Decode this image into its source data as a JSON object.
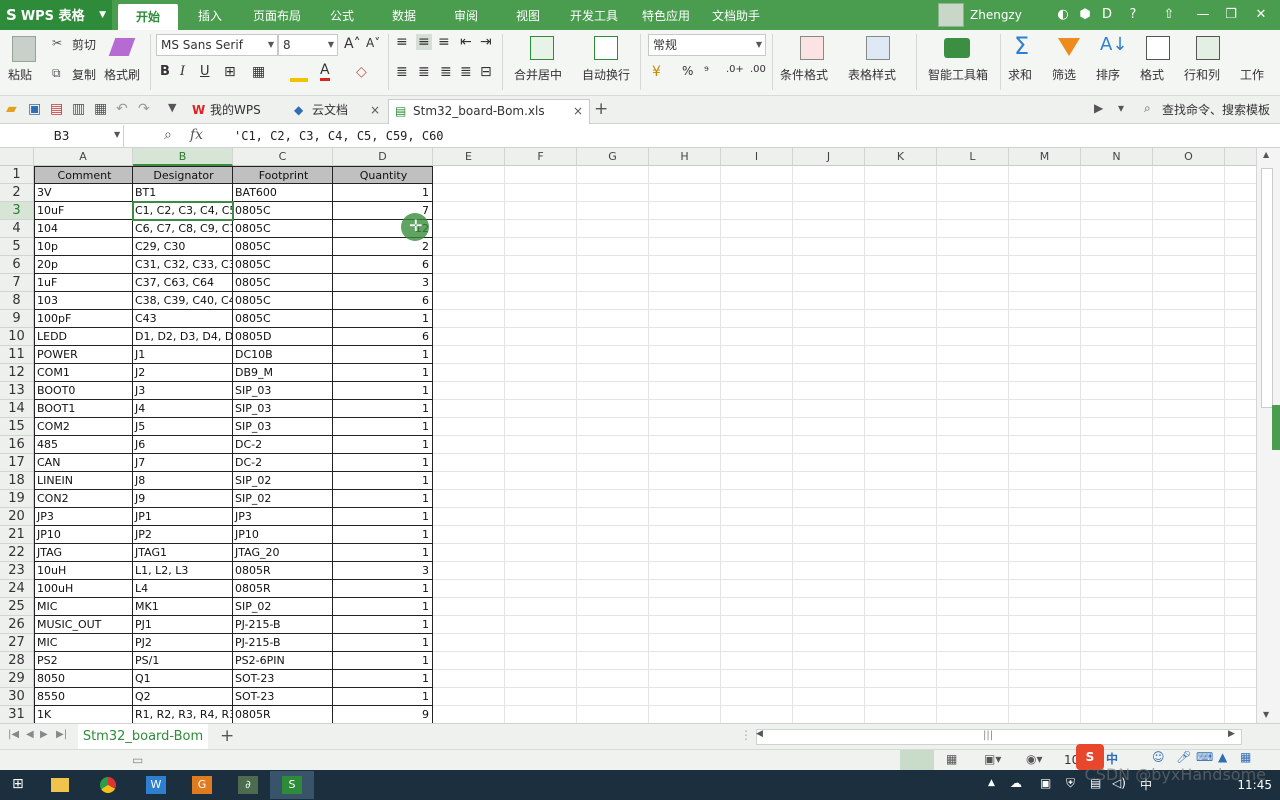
{
  "app": {
    "logo": "WPS 表格",
    "logo_mark": "S",
    "user": "Zhengzy"
  },
  "menu": {
    "tabs": [
      "开始",
      "插入",
      "页面布局",
      "公式",
      "数据",
      "审阅",
      "视图",
      "开发工具",
      "特色应用",
      "文档助手"
    ],
    "active": 0
  },
  "ribbon": {
    "paste": "粘贴",
    "cut": "剪切",
    "copy": "复制",
    "format_painter": "格式刷",
    "font_name": "MS Sans Serif",
    "font_size": "8",
    "merge_center": "合并居中",
    "wrap": "自动换行",
    "number_format": "常规",
    "cond_format": "条件格式",
    "table_style": "表格样式",
    "smart_toolbox": "智能工具箱",
    "sum": "求和",
    "filter": "筛选",
    "sort": "排序",
    "format": "格式",
    "rows_cols": "行和列",
    "worksheet": "工作",
    "bold": "B",
    "italic": "I",
    "underline": "U",
    "percent": "%",
    "thousands": "⁹"
  },
  "docbar": {
    "my_wps": "我的WPS",
    "cloud_docs": "云文档",
    "file_tab": "Stm32_board-Bom.xls",
    "search_placeholder": "查找命令、搜索模板"
  },
  "formula_bar": {
    "cell_ref": "B3",
    "fx": "fx",
    "content": "'C1, C2, C3, C4, C5, C59, C60"
  },
  "columns": [
    "A",
    "B",
    "C",
    "D",
    "E",
    "F",
    "G",
    "H",
    "I",
    "J",
    "K",
    "L",
    "M",
    "N",
    "O"
  ],
  "headers": [
    "Comment",
    "Designator",
    "Footprint",
    "Quantity"
  ],
  "rows": [
    [
      "3V",
      "BT1",
      "BAT600",
      "1"
    ],
    [
      "10uF",
      "C1, C2, C3, C4, C5,",
      "0805C",
      "7"
    ],
    [
      "104",
      "C6, C7, C8, C9, C10,",
      "0805C",
      "12"
    ],
    [
      "10p",
      "C29, C30",
      "0805C",
      "2"
    ],
    [
      "20p",
      "C31, C32, C33, C34,",
      "0805C",
      "6"
    ],
    [
      "1uF",
      "C37, C63, C64",
      "0805C",
      "3"
    ],
    [
      "103",
      "C38, C39, C40, C41,",
      "0805C",
      "6"
    ],
    [
      "100pF",
      "C43",
      "0805C",
      "1"
    ],
    [
      "LEDD",
      "D1, D2, D3, D4, D5, I",
      "0805D",
      "6"
    ],
    [
      "POWER",
      "J1",
      "DC10B",
      "1"
    ],
    [
      "COM1",
      "J2",
      "DB9_M",
      "1"
    ],
    [
      "BOOT0",
      "J3",
      "SIP_03",
      "1"
    ],
    [
      "BOOT1",
      "J4",
      "SIP_03",
      "1"
    ],
    [
      "COM2",
      "J5",
      "SIP_03",
      "1"
    ],
    [
      "485",
      "J6",
      "DC-2",
      "1"
    ],
    [
      "CAN",
      "J7",
      "DC-2",
      "1"
    ],
    [
      "LINEIN",
      "J8",
      "SIP_02",
      "1"
    ],
    [
      "CON2",
      "J9",
      "SIP_02",
      "1"
    ],
    [
      "JP3",
      "JP1",
      "JP3",
      "1"
    ],
    [
      "JP10",
      "JP2",
      "JP10",
      "1"
    ],
    [
      "JTAG",
      "JTAG1",
      "JTAG_20",
      "1"
    ],
    [
      "10uH",
      "L1, L2, L3",
      "0805R",
      "3"
    ],
    [
      "100uH",
      "L4",
      "0805R",
      "1"
    ],
    [
      "MIC",
      "MK1",
      "SIP_02",
      "1"
    ],
    [
      "MUSIC_OUT",
      "PJ1",
      "PJ-215-B",
      "1"
    ],
    [
      "MIC",
      "PJ2",
      "PJ-215-B",
      "1"
    ],
    [
      "PS2",
      "PS/1",
      "PS2-6PIN",
      "1"
    ],
    [
      "8050",
      "Q1",
      "SOT-23",
      "1"
    ],
    [
      "8550",
      "Q2",
      "SOT-23",
      "1"
    ],
    [
      "1K",
      "R1, R2, R3, R4, R33",
      "0805R",
      "9"
    ]
  ],
  "row_numbers": [
    "1",
    "2",
    "3",
    "4",
    "5",
    "6",
    "7",
    "8",
    "9",
    "10",
    "11",
    "12",
    "13",
    "14",
    "15",
    "16",
    "17",
    "18",
    "19",
    "20",
    "21",
    "22",
    "23",
    "24",
    "25",
    "26",
    "27",
    "28",
    "29",
    "30",
    "31"
  ],
  "sheet_tab": "Stm32_board-Bom",
  "status": {
    "zoom": "10"
  },
  "taskbar": {
    "time": "11:45",
    "ime": "中"
  },
  "watermark": "CSDN @byxHandsome",
  "colors": {
    "brand": "#4a9c4f",
    "selection": "#3d8b40",
    "header_fill": "#c0c0c0"
  }
}
